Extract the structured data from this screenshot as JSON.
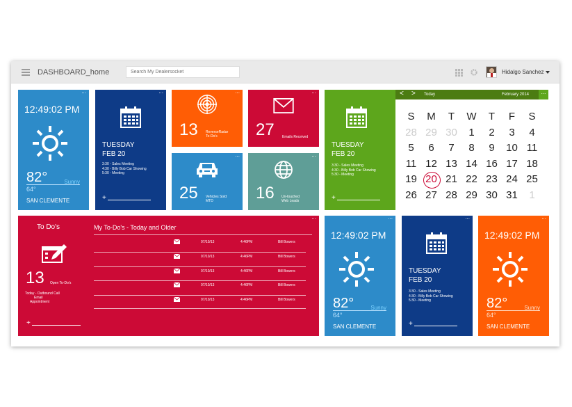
{
  "topbar": {
    "title": "DASHBOARD_home",
    "search_placeholder": "Search My Dealersocket",
    "user_name": "Hidalgo Sanchez"
  },
  "weather_tiles": [
    {
      "time": "12:49:02 PM",
      "temp": "82°",
      "condition": "Sunny",
      "low": "64°",
      "city": "SAN CLEMENTE",
      "color": "#2d8bc9"
    },
    {
      "time": "12:49:02 PM",
      "temp": "82°",
      "condition": "Sunny",
      "low": "64°",
      "city": "SAN CLEMENTE",
      "color": "#2d8bc9"
    },
    {
      "time": "12:49:02 PM",
      "temp": "82°",
      "condition": "Sunny",
      "low": "64°",
      "city": "SAN CLEMENTE",
      "color": "#ff5d05"
    }
  ],
  "calendar_tiles": [
    {
      "day": "TUESDAY",
      "date": "FEB 20",
      "events": [
        "3:30 - Sales Meeting",
        "4:30 - Billy Bob Car Showing",
        "5:30 - Meeting"
      ],
      "color": "#0e3b87"
    },
    {
      "day": "TUESDAY",
      "date": "FEB 20",
      "events": [
        "3:30 - Sales Meeting",
        "4:30 - Billy Bob Car Showing",
        "5:30 - Meeting"
      ],
      "color": "#5da61c"
    },
    {
      "day": "TUESDAY",
      "date": "FEB 20",
      "events": [
        "3:30 - Sales Meeting",
        "4:30 - Billy Bob Car Showing",
        "5:30 - Meeting"
      ],
      "color": "#0e3b87"
    }
  ],
  "stat_tiles": {
    "radar": {
      "value": "13",
      "label_1": "ReverseRadar",
      "label_2": "To-Do's",
      "icon": "radar-icon",
      "color": "#ff5d05"
    },
    "emails": {
      "value": "27",
      "label_1": "Emails Received",
      "label_2": "",
      "icon": "envelope-icon",
      "color": "#cc0a36"
    },
    "vehicles": {
      "value": "25",
      "label_1": "Vehicles Sold",
      "label_2": "MTD",
      "icon": "car-icon",
      "color": "#2d8bc9"
    },
    "web_leads": {
      "value": "16",
      "label_1": "Un-touched",
      "label_2": "Web Leads",
      "icon": "globe-icon",
      "color": "#5f9e97"
    }
  },
  "month_calendar": {
    "prev": "<",
    "next": ">",
    "today": "Today",
    "month_label": "February 2014",
    "weekdays": [
      "S",
      "M",
      "T",
      "W",
      "T",
      "F",
      "S"
    ],
    "selected_day": 20,
    "weeks": [
      [
        {
          "d": "28",
          "dim": true
        },
        {
          "d": "29",
          "dim": true
        },
        {
          "d": "30",
          "dim": true
        },
        {
          "d": "1"
        },
        {
          "d": "2"
        },
        {
          "d": "3"
        },
        {
          "d": "4"
        }
      ],
      [
        {
          "d": "5"
        },
        {
          "d": "6"
        },
        {
          "d": "7"
        },
        {
          "d": "8"
        },
        {
          "d": "9"
        },
        {
          "d": "10"
        },
        {
          "d": "11"
        }
      ],
      [
        {
          "d": "11"
        },
        {
          "d": "12"
        },
        {
          "d": "13"
        },
        {
          "d": "14"
        },
        {
          "d": "16"
        },
        {
          "d": "17"
        },
        {
          "d": "18"
        }
      ],
      [
        {
          "d": "19"
        },
        {
          "d": "20",
          "sel": true
        },
        {
          "d": "21"
        },
        {
          "d": "22"
        },
        {
          "d": "23"
        },
        {
          "d": "24"
        },
        {
          "d": "25"
        }
      ],
      [
        {
          "d": "26"
        },
        {
          "d": "27"
        },
        {
          "d": "28"
        },
        {
          "d": "29"
        },
        {
          "d": "30"
        },
        {
          "d": "31"
        },
        {
          "d": "1",
          "dim": true
        }
      ]
    ]
  },
  "todo": {
    "title": "To Do's",
    "count": "13",
    "count_label": "Open To-Do's",
    "desc_1": "Today - Outbound Call",
    "desc_2": "Email",
    "desc_3": "Appointment",
    "list_title": "My To-Do's - Today and Older",
    "rows": [
      {
        "date": "07/10/13",
        "time": "4:46PM",
        "name": "Bill Bowers"
      },
      {
        "date": "07/10/13",
        "time": "4:46PM",
        "name": "Bill Bowers"
      },
      {
        "date": "07/10/13",
        "time": "4:46PM",
        "name": "Bill Bowers"
      },
      {
        "date": "07/10/13",
        "time": "4:46PM",
        "name": "Bill Bowers"
      },
      {
        "date": "07/10/13",
        "time": "4:46PM",
        "name": "Bill Bowers"
      }
    ],
    "color": "#cc0a36"
  },
  "tile_menu_label": "...",
  "add_label": "+"
}
